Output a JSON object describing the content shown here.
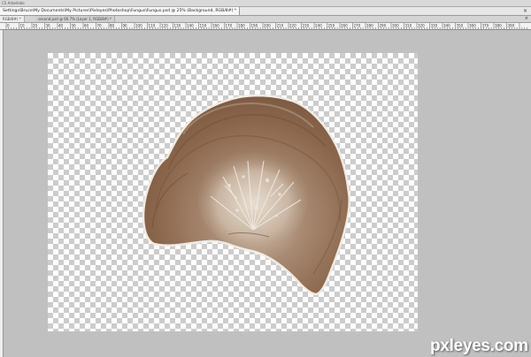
{
  "app": {
    "top_strip": {
      "left_label": "CS Arbeitsbe",
      "mid_label": ""
    },
    "document_tab": {
      "title": "Settings\\Bruce\\My Documents\\My Pictures\\Pixleyes\\Photoshop\\Fungus\\Fungus.psd @ 25% (Background, RGB/8#) *",
      "close_glyph": "×"
    },
    "secondary_tabs": [
      {
        "label": "RGB/8#) *"
      },
      {
        "label": "second.psd @ 66.7% (Layer 1, RGB/8#) *"
      }
    ],
    "secondary_close_glyph": "×",
    "ruler_labels": [
      "0",
      "10",
      "20",
      "30",
      "40",
      "50",
      "60",
      "70",
      "80",
      "90",
      "100",
      "110",
      "120",
      "130",
      "140",
      "150",
      "160",
      "170",
      "180",
      "190",
      "200",
      "210",
      "220",
      "230",
      "240",
      "250",
      "260",
      "270",
      "280",
      "290",
      "300",
      "310",
      "320",
      "330",
      "340",
      "350",
      "360",
      "370",
      "380",
      "390"
    ]
  },
  "colors": {
    "workspace": "#c0c0c0",
    "checker_light": "#ffffff",
    "checker_dark": "#cccccc",
    "fungus_base": "#8d6a50",
    "fungus_light": "#d6c7b6",
    "fungus_edge": "#f3ece4"
  },
  "icons": {
    "close": "close-icon"
  },
  "watermark": "pxleyes.com"
}
